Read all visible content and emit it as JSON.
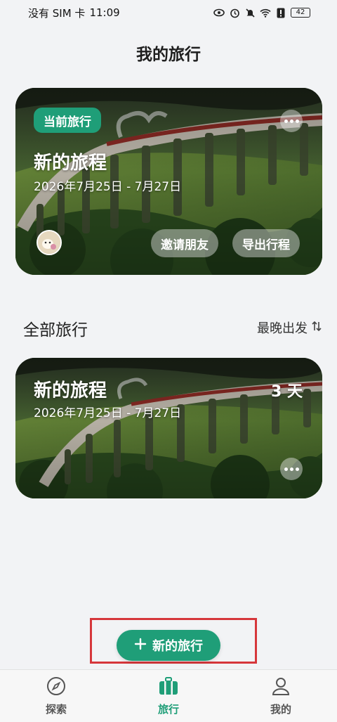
{
  "status_bar": {
    "carrier": "没有 SIM 卡",
    "time": "11:09",
    "battery": "42",
    "icons": [
      "eye-icon",
      "alarm-icon",
      "mute-icon",
      "wifi-icon",
      "alert-icon",
      "battery-icon"
    ]
  },
  "header": {
    "title": "我的旅行"
  },
  "current_trip": {
    "badge": "当前旅行",
    "name": "新的旅程",
    "dates": "2026年7月25日  - 7月27日",
    "invite_label": "邀请朋友",
    "export_label": "导出行程"
  },
  "all_trips": {
    "title": "全部旅行",
    "sort_label": "最晚出发",
    "items": [
      {
        "name": "新的旅程",
        "dates": "2026年7月25日  - 7月27日",
        "duration": "3 天"
      }
    ]
  },
  "new_trip_button": {
    "label": "新的旅行"
  },
  "bottom_nav": {
    "items": [
      {
        "label": "探索",
        "icon": "compass-icon",
        "active": false
      },
      {
        "label": "旅行",
        "icon": "suitcase-icon",
        "active": true
      },
      {
        "label": "我的",
        "icon": "person-icon",
        "active": false
      }
    ]
  },
  "colors": {
    "accent": "#1f9e78",
    "highlight": "#d6373b",
    "background": "#f2f3f5"
  }
}
